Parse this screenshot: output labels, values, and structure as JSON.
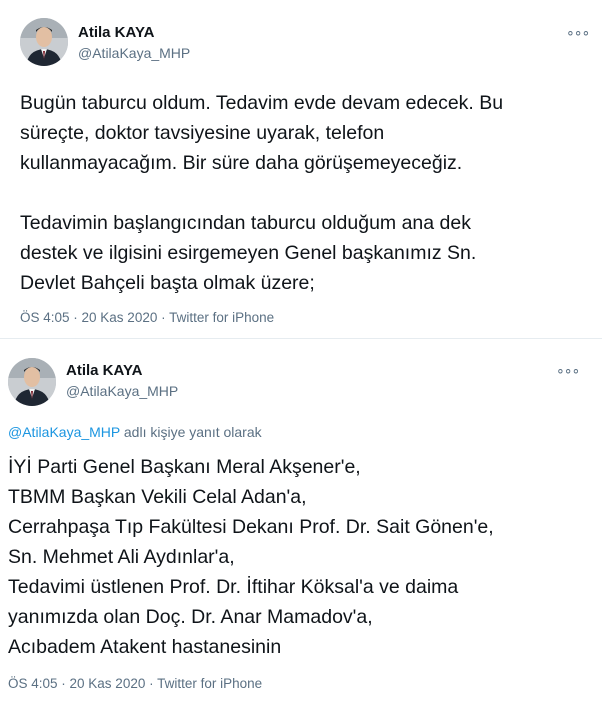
{
  "tweets": [
    {
      "display_name": "Atila KAYA",
      "handle": "@AtilaKaya_MHP",
      "more_icon": "more-dots-icon",
      "text": "Bugün taburcu oldum. Tedavim evde devam edecek. Bu\nsüreçte, doktor tavsiyesine uyarak, telefon\nkullanmayacağım. Bir süre daha görüşemeyeceğiz.\n\nTedavimin başlangıcından taburcu olduğum ana dek\ndestek ve ilgisini esirgemeyen Genel başkanımız Sn.\nDevlet Bahçeli başta olmak üzere;",
      "time": "ÖS 4:05",
      "date": "20 Kas 2020",
      "source": "Twitter for iPhone"
    },
    {
      "display_name": "Atila KAYA",
      "handle": "@AtilaKaya_MHP",
      "more_icon": "more-dots-icon",
      "reply_to_handle": "@AtilaKaya_MHP",
      "reply_suffix": "adlı kişiye yanıt olarak",
      "text": "İYİ Parti Genel Başkanı Meral Akşener'e,\nTBMM Başkan Vekili Celal Adan'a,\nCerrahpaşa Tıp Fakültesi Dekanı Prof. Dr. Sait Gönen'e,\nSn. Mehmet Ali Aydınlar'a,\nTedavimi üstlenen Prof. Dr. İftihar Köksal'a ve daima\nyanımızda olan Doç. Dr. Anar Mamadov'a,\nAcıbadem Atakent hastanesinin",
      "time": "ÖS 4:05",
      "date": "20 Kas 2020",
      "source": "Twitter for iPhone"
    }
  ],
  "separator": " · "
}
